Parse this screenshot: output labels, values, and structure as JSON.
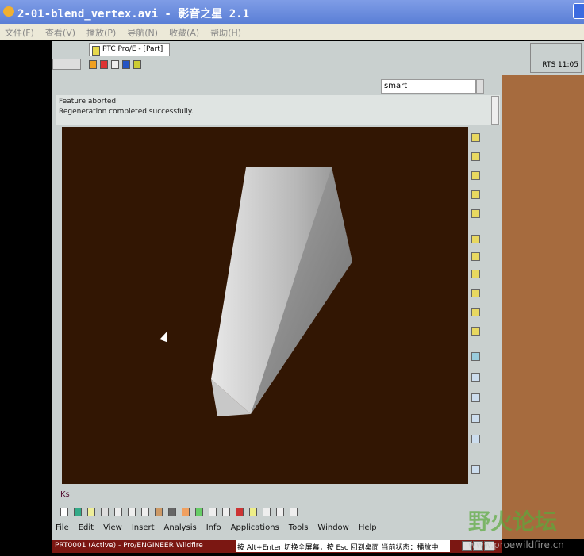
{
  "window": {
    "title": "2-01-blend_vertex.avi - 影音之星 2.1"
  },
  "menu": [
    "文件(F)",
    "查看(V)",
    "播放(P)",
    "导航(N)",
    "收藏(A)",
    "帮助(H)"
  ],
  "app": {
    "tab_label": "PTC Pro/E - [Part]",
    "status_right": "RTS 11:05",
    "search_value": "smart",
    "messages": [
      "Regeneration completed successfully.",
      "Feature aborted."
    ],
    "command_label": "Ks",
    "main_menu": [
      "File",
      "Edit",
      "View",
      "Insert",
      "Analysis",
      "Info",
      "Applications",
      "Tools",
      "Window",
      "Help"
    ],
    "taskbar_title": "PRT0001 (Active) - Pro/ENGINEER Wildfire",
    "taskbar_message": "按 Alt+Enter 切换全屏幕，按 Esc 回到桌面  当前状态：播放中"
  },
  "watermark": {
    "text": "野火论坛",
    "url": "www.proewildfire.cn"
  },
  "colors": {
    "viewport": "#321603",
    "title": "#5a7fd6",
    "side": "#a66b3e"
  }
}
